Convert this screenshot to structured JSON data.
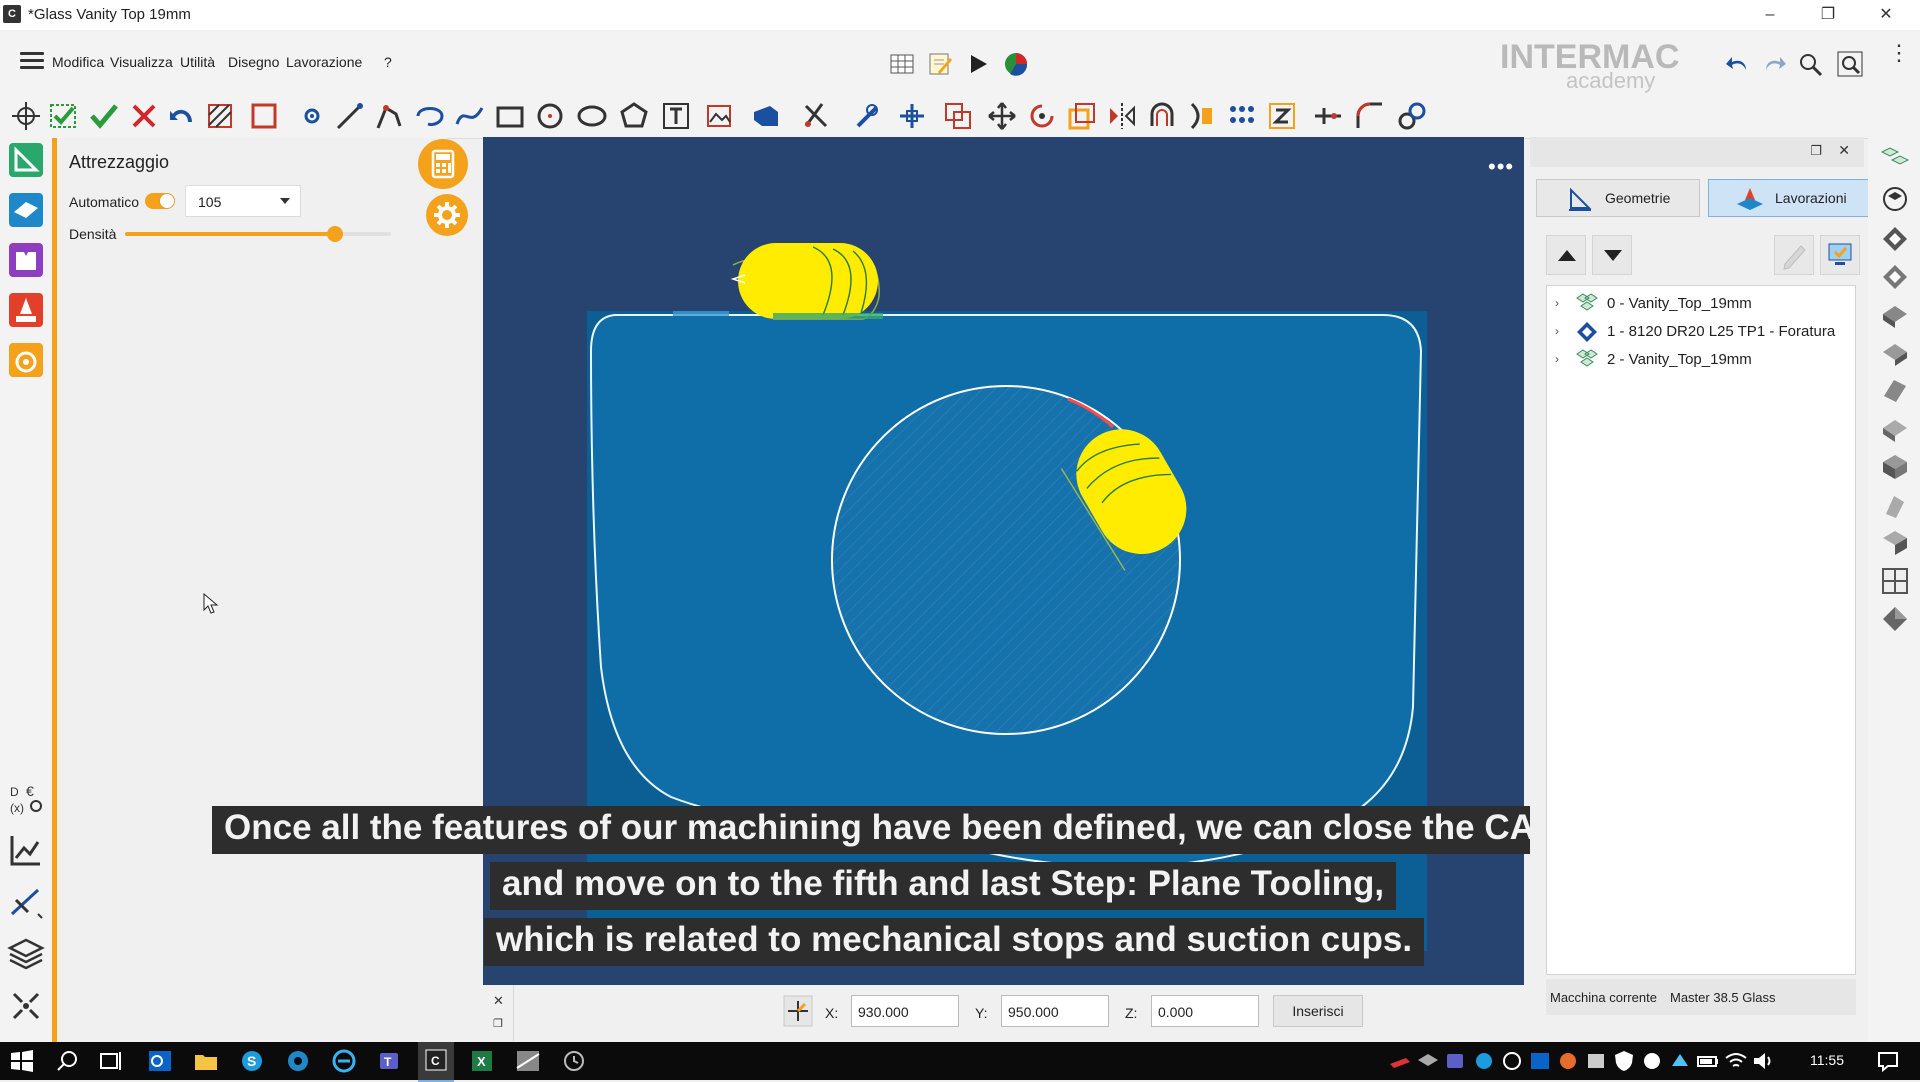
{
  "window": {
    "app_icon": "C",
    "title": "*Glass Vanity Top 19mm",
    "controls": [
      "minimize-icon",
      "restore-icon",
      "close-icon"
    ]
  },
  "menu": {
    "items": [
      "Modifica",
      "Visualizza",
      "Utilità",
      "Disegno",
      "Lavorazione",
      "?"
    ]
  },
  "brand": {
    "name": "INTERMAC",
    "sub": "academy"
  },
  "tool_panel": {
    "title": "Attrezzaggio",
    "auto_label": "Automatico",
    "auto_on": true,
    "combo_value": "105",
    "density_label": "Densità",
    "density_level": 0.79
  },
  "subtitles": [
    "Once all the features of our machining have been defined, we can close the CAM Step",
    "and move on to the fifth and last Step: Plane Tooling,",
    "which is related to mechanical stops and suction cups."
  ],
  "coords": {
    "x_label": "X:",
    "x_value": "930.000",
    "y_label": "Y:",
    "y_value": "950.000",
    "z_label": "Z:",
    "z_value": "0.000",
    "insert_label": "Inserisci"
  },
  "right_panel": {
    "tabs": {
      "geometry": "Geometrie",
      "machining": "Lavorazioni"
    },
    "active_tab": "Lavorazioni",
    "tree": [
      "0 - Vanity_Top_19mm",
      "1 - 8120 DR20 L25 TP1 - Foratura",
      "2 - Vanity_Top_19mm"
    ],
    "machine_label": "Macchina corrente",
    "machine_value": "Master 38.5 Glass"
  },
  "taskbar": {
    "clock": "11:55"
  },
  "colors": {
    "accent": "#f4a21b",
    "viewport_bg": "#274470",
    "panel_blue": "#0b5f95",
    "tool_yellow": "#ffec00",
    "active_tab": "#cfe3f6"
  }
}
